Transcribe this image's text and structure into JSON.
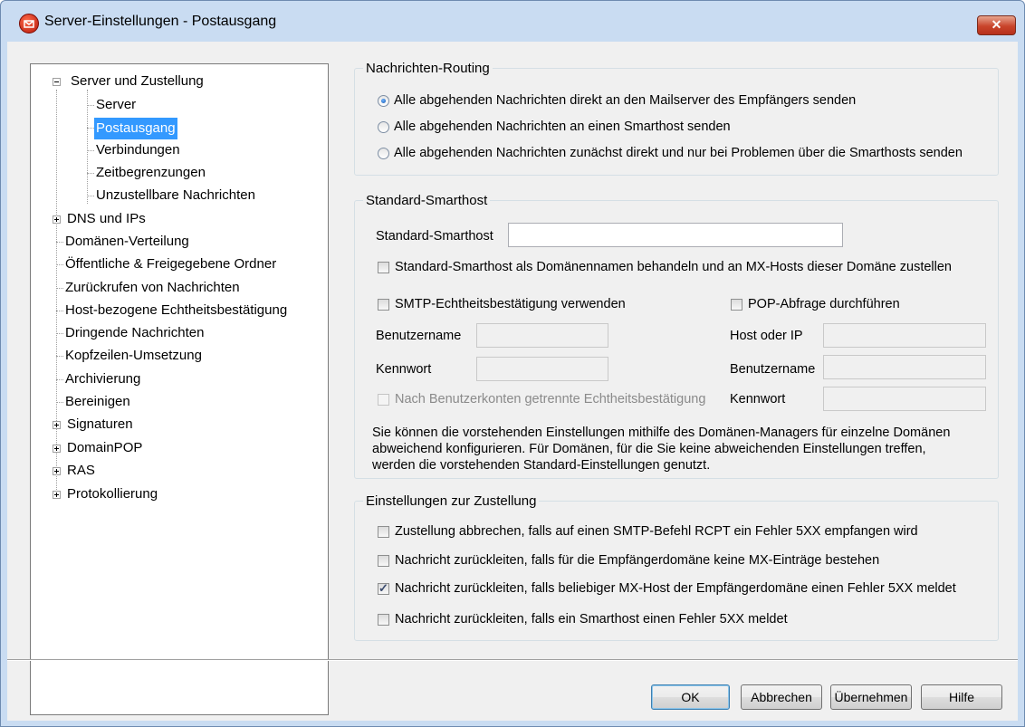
{
  "window": {
    "title": "Server-Einstellungen - Postausgang",
    "close_label": "✕"
  },
  "tree": {
    "items": [
      {
        "label": "Server und Zustellung",
        "expander": "minus"
      },
      {
        "label": "Server"
      },
      {
        "label": "Postausgang",
        "selected": true
      },
      {
        "label": "Verbindungen"
      },
      {
        "label": "Zeitbegrenzungen"
      },
      {
        "label": "Unzustellbare Nachrichten"
      },
      {
        "label": "DNS und IPs",
        "expander": "plus"
      },
      {
        "label": "Domänen-Verteilung"
      },
      {
        "label": "Öffentliche & Freigegebene Ordner"
      },
      {
        "label": "Zurückrufen von Nachrichten"
      },
      {
        "label": "Host-bezogene Echtheitsbestätigung"
      },
      {
        "label": "Dringende Nachrichten"
      },
      {
        "label": "Kopfzeilen-Umsetzung"
      },
      {
        "label": "Archivierung"
      },
      {
        "label": "Bereinigen"
      },
      {
        "label": "Signaturen",
        "expander": "plus"
      },
      {
        "label": "DomainPOP",
        "expander": "plus"
      },
      {
        "label": "RAS",
        "expander": "plus"
      },
      {
        "label": "Protokollierung",
        "expander": "plus"
      }
    ]
  },
  "routing": {
    "legend": "Nachrichten-Routing",
    "options": [
      {
        "label": "Alle abgehenden Nachrichten direkt an den Mailserver des Empfängers senden",
        "selected": true
      },
      {
        "label": "Alle abgehenden Nachrichten an einen Smarthost senden",
        "selected": false
      },
      {
        "label": "Alle abgehenden Nachrichten zunächst direkt und nur bei Problemen über die Smarthosts senden",
        "selected": false
      }
    ]
  },
  "smarthost": {
    "legend": "Standard-Smarthost",
    "field_label": "Standard-Smarthost",
    "field_value": "",
    "mx_checkbox": "Standard-Smarthost als Domänennamen behandeln und an MX-Hosts dieser Domäne zustellen",
    "smtp_auth": "SMTP-Echtheitsbestätigung verwenden",
    "username_label": "Benutzername",
    "password_label": "Kennwort",
    "separate_auth": "Nach Benutzerkonten getrennte Echtheitsbestätigung",
    "pop_check": "POP-Abfrage durchführen",
    "host_label": "Host oder IP",
    "pop_username_label": "Benutzername",
    "pop_password_label": "Kennwort",
    "note_line1": "Sie können die vorstehenden Einstellungen mithilfe des Domänen-Managers für einzelne Domänen",
    "note_line2": "abweichend konfigurieren. Für Domänen, für die Sie keine abweichenden Einstellungen treffen,",
    "note_line3": "werden die vorstehenden Standard-Einstellungen genutzt."
  },
  "delivery": {
    "legend": "Einstellungen zur Zustellung",
    "options": [
      {
        "label": "Zustellung abbrechen, falls auf einen SMTP-Befehl RCPT ein Fehler 5XX empfangen wird",
        "checked": false
      },
      {
        "label": "Nachricht zurückleiten, falls für die Empfängerdomäne keine MX-Einträge bestehen",
        "checked": false
      },
      {
        "label": "Nachricht zurückleiten, falls beliebiger MX-Host der Empfängerdomäne einen Fehler 5XX meldet",
        "checked": true
      },
      {
        "label": "Nachricht zurückleiten, falls ein Smarthost einen Fehler 5XX meldet",
        "checked": false
      }
    ]
  },
  "buttons": {
    "ok": "OK",
    "cancel": "Abbrechen",
    "apply": "Übernehmen",
    "help": "Hilfe"
  }
}
